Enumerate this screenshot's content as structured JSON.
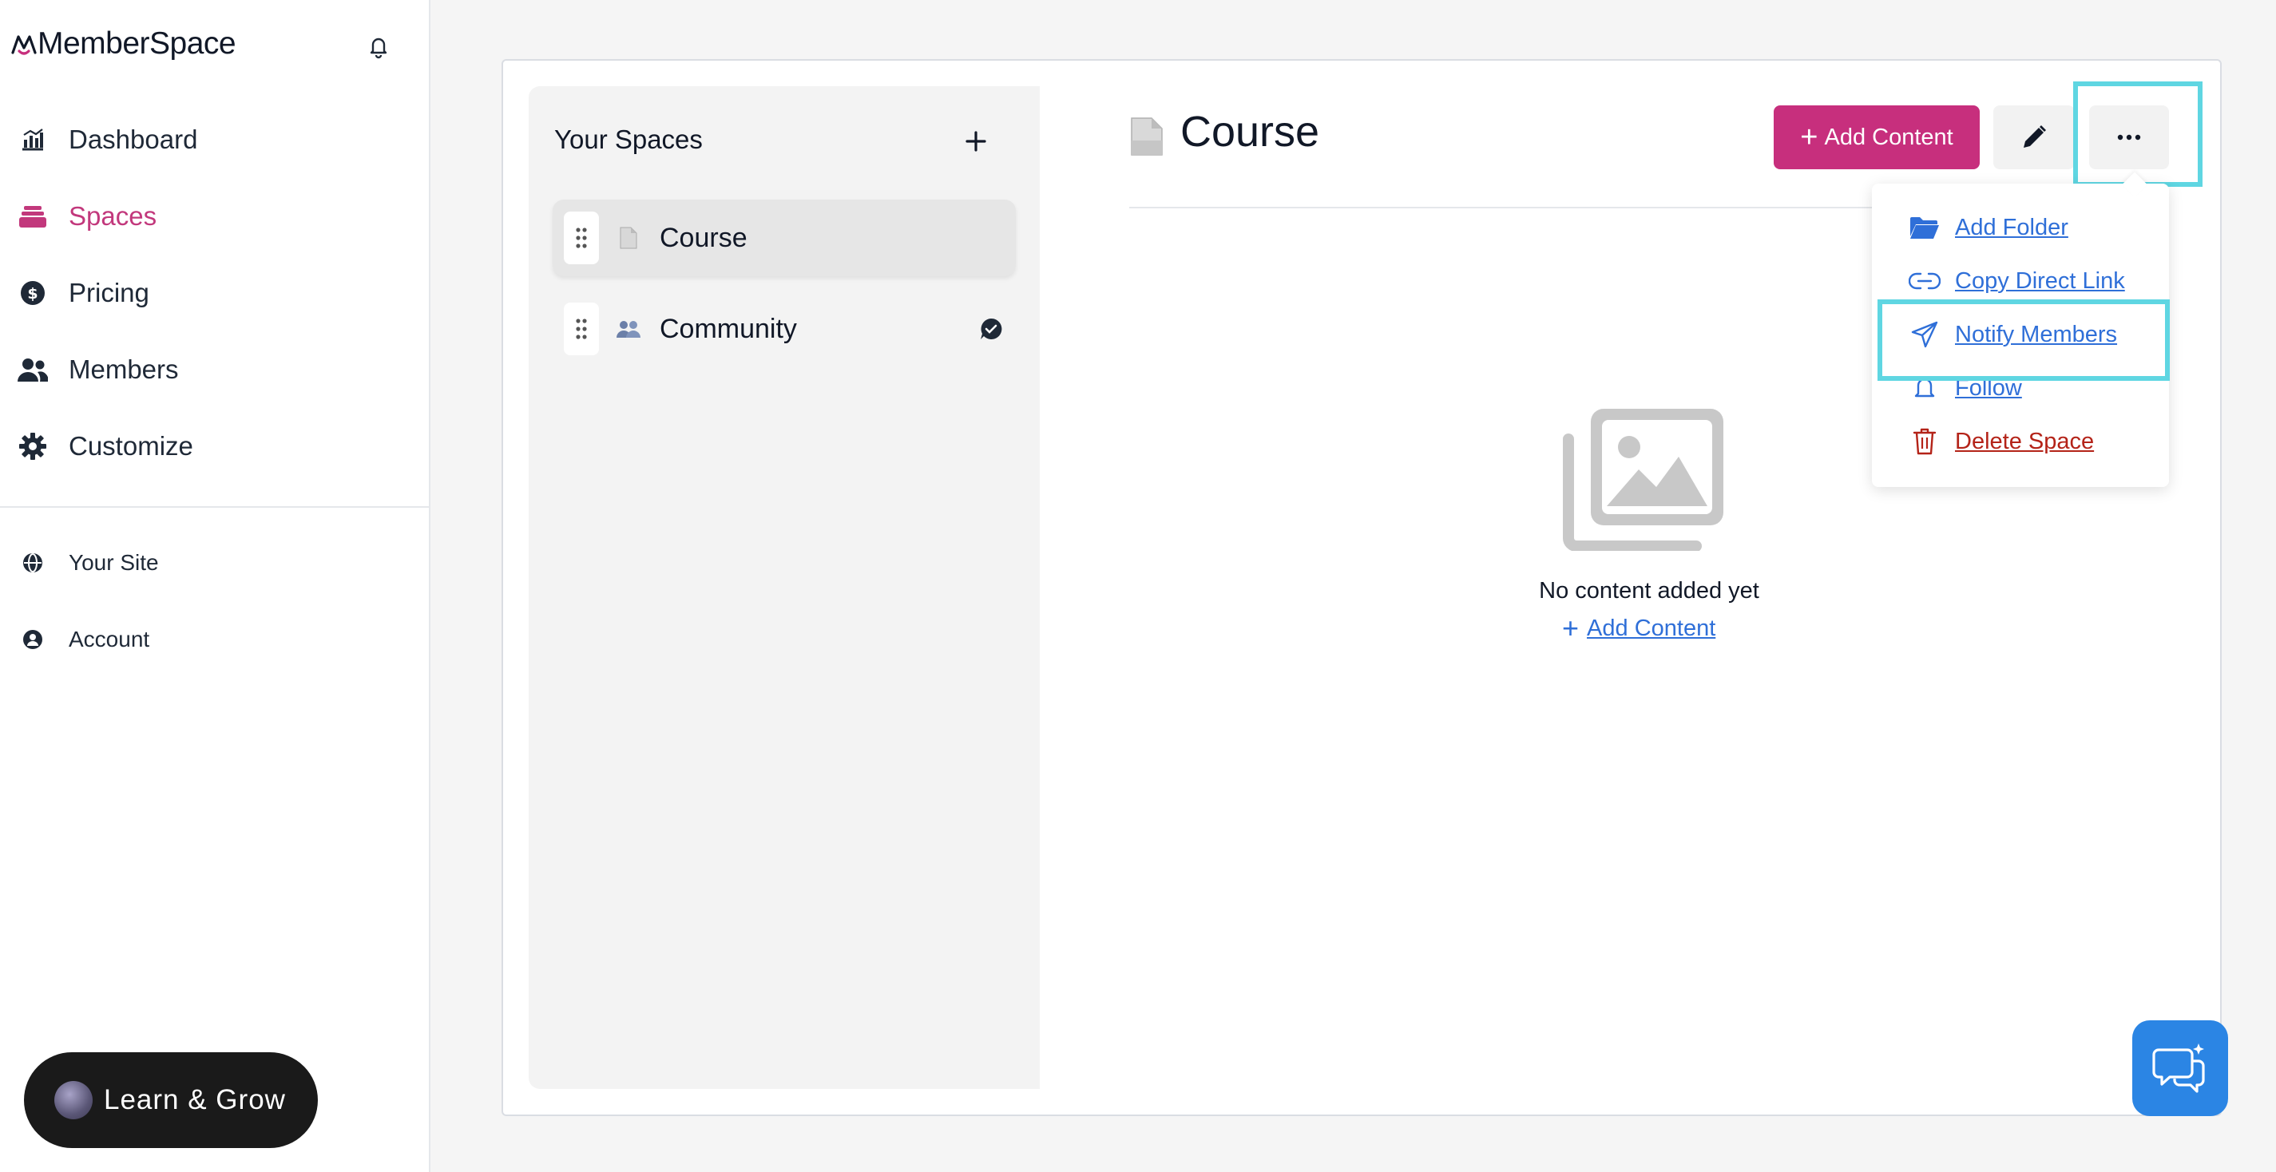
{
  "app": {
    "name": "MemberSpace"
  },
  "sidebar": {
    "items": [
      {
        "label": "Dashboard",
        "icon": "chart-icon"
      },
      {
        "label": "Spaces",
        "icon": "layers-icon"
      },
      {
        "label": "Pricing",
        "icon": "dollar-icon"
      },
      {
        "label": "Members",
        "icon": "users-icon"
      },
      {
        "label": "Customize",
        "icon": "gear-icon"
      }
    ],
    "secondary": [
      {
        "label": "Your Site",
        "icon": "globe-icon"
      },
      {
        "label": "Account",
        "icon": "account-icon"
      }
    ],
    "learn_label": "Learn & Grow"
  },
  "spaces": {
    "title": "Your Spaces",
    "items": [
      {
        "label": "Course",
        "icon": "document-icon"
      },
      {
        "label": "Community",
        "icon": "people-icon"
      }
    ]
  },
  "content": {
    "title": "Course",
    "add_button": "Add Content",
    "empty_text": "No content added yet",
    "empty_link": "Add Content"
  },
  "menu": {
    "items": [
      {
        "label": "Add Folder",
        "icon": "folder-icon"
      },
      {
        "label": "Copy Direct Link",
        "icon": "link-icon"
      },
      {
        "label": "Notify Members",
        "icon": "send-icon"
      },
      {
        "label": "Follow",
        "icon": "bell-icon"
      },
      {
        "label": "Delete Space",
        "icon": "trash-icon"
      }
    ]
  },
  "colors": {
    "accent": "#c72f7d",
    "active_nav": "#c2387c",
    "link": "#2f6fd8",
    "danger": "#b42318",
    "highlight": "#5fd6e2",
    "chat": "#2b85e4"
  }
}
